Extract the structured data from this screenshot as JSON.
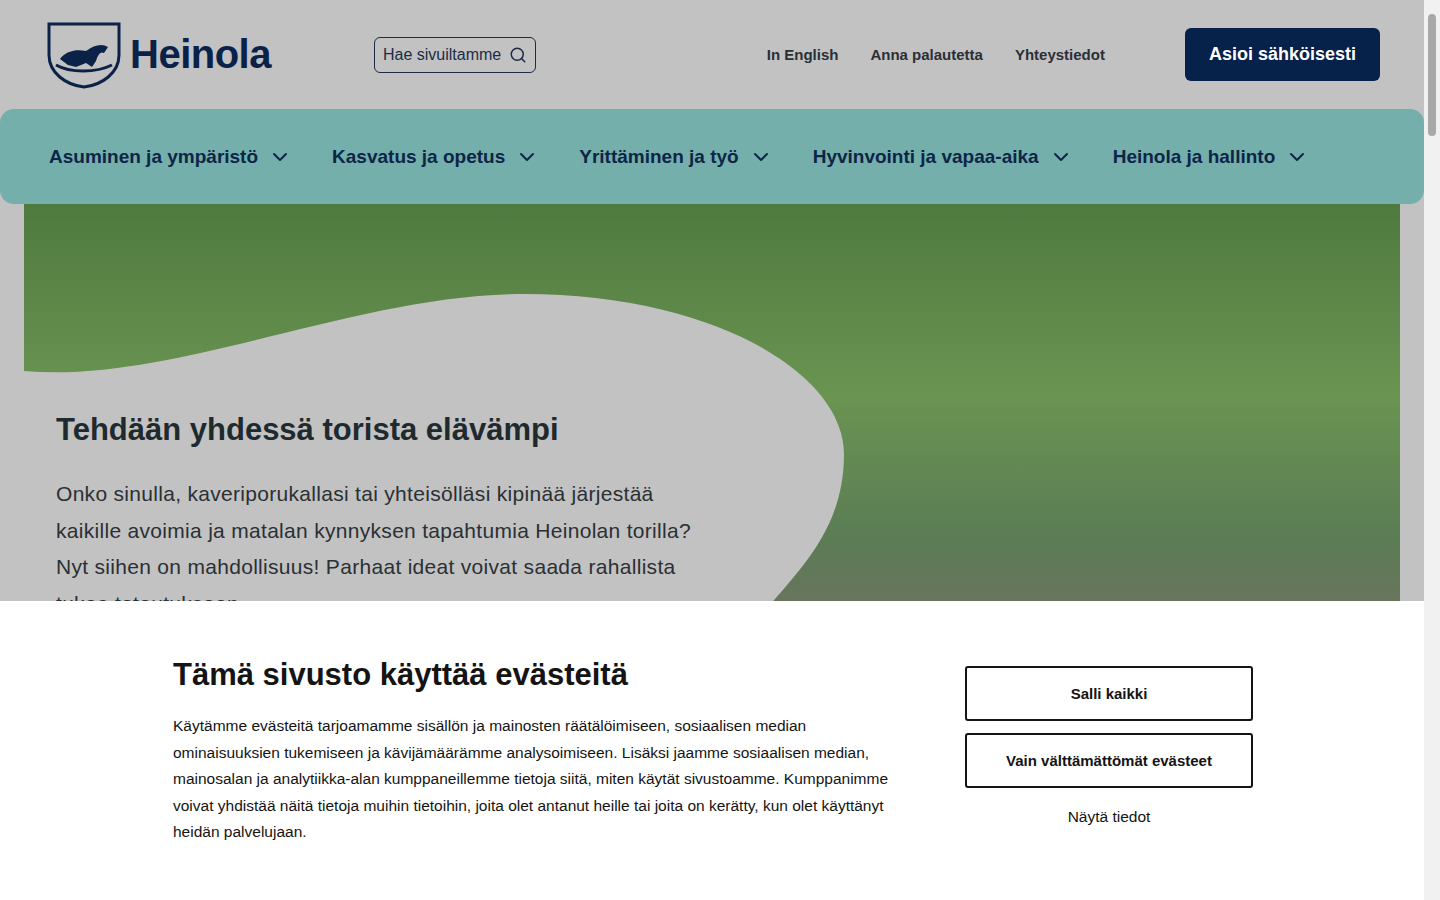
{
  "header": {
    "logo": "Heinola",
    "search": {
      "placeholder": "Hae sivuiltamme"
    },
    "links": [
      "In English",
      "Anna palautetta",
      "Yhteystiedot"
    ],
    "cta": "Asioi sähköisesti"
  },
  "nav": [
    {
      "label": "Asuminen ja ympäristö",
      "expanded": false
    },
    {
      "label": "Kasvatus ja opetus",
      "expanded": false
    },
    {
      "label": "Yrittäminen ja työ",
      "expanded": false
    },
    {
      "label": "Hyvinvointi ja vapaa-aika",
      "expanded": false
    },
    {
      "label": "Heinola ja hallinto",
      "expanded": false
    }
  ],
  "hero": {
    "title": "Tehdään yhdessä torista elävämpi",
    "text": "Onko sinulla, kaveriporukallasi tai yhteisölläsi kipinää järjestää kaikille avoimia ja matalan kynnyksen tapahtumia Heinolan torilla? Nyt siihen on mahdollisuus! Parhaat ideat voivat saada rahallista tukea toteutukseen"
  },
  "cookie_banner": {
    "title": "Tämä sivusto käyttää evästeitä",
    "text": "Käytämme evästeitä tarjoamamme sisällön ja mainosten räätälöimiseen, sosiaalisen median ominaisuuksien tukemiseen ja kävijämäärämme analysoimiseen. Lisäksi jaamme sosiaalisen median, mainosalan ja analytiikka-alan kumppaneillemme tietoja siitä, miten käytät sivustoamme. Kumppanimme voivat yhdistää näitä tietoja muihin tietoihin, joita olet antanut heille tai joita on kerätty, kun olet käyttänyt heidän palvelujaan.",
    "buttons": [
      "Salli kaikki",
      "Vain välttämättömät evästeet"
    ],
    "details": "Näytä tiedot"
  }
}
